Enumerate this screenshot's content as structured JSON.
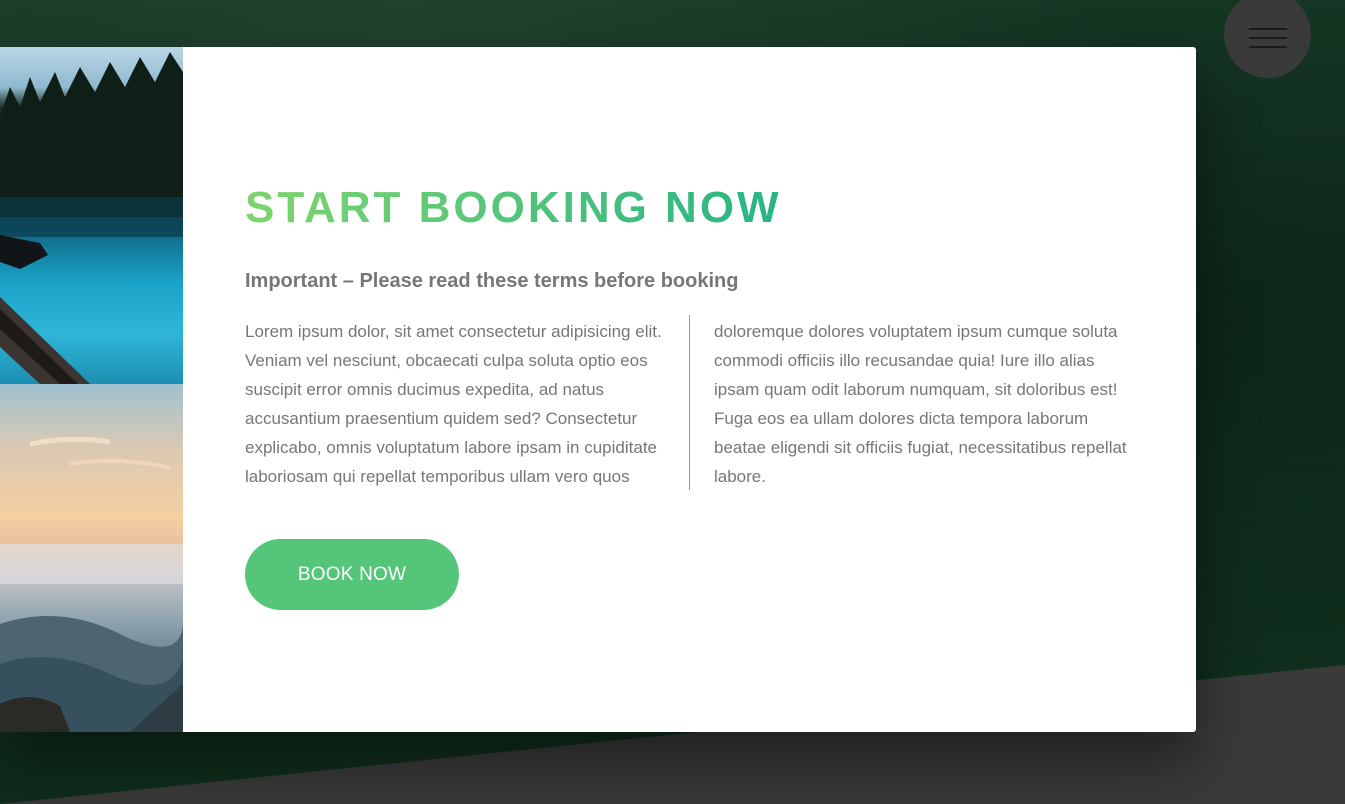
{
  "popup": {
    "title": "START BOOKING NOW",
    "subtitle": "Important – Please read these terms before booking",
    "text_col1": "Lorem ipsum dolor, sit amet consectetur adipisicing elit. Veniam vel nesciunt, obcaecati culpa soluta optio eos suscipit error omnis ducimus expedita, ad natus accusantium praesentium quidem sed? Consectetur explicabo, omnis voluptatum labore ipsam in cupiditate laboriosam qui repellat temporibus ullam vero quos",
    "text_col2": "doloremque dolores voluptatem ipsum cumque soluta commodi officiis illo recusandae quia! Iure illo alias ipsam quam odit laborum numquam, sit doloribus est! Fuga eos ea ullam dolores dicta tempora laborum beatae eligendi sit officiis fugiat, necessitatibus repellat labore.",
    "book_button_label": "Book now",
    "images": [
      "lake-with-boat-image",
      "mountain-sunrise-image"
    ]
  },
  "navigation": {
    "menu_icon": "hamburger-menu-icon"
  },
  "colors": {
    "accent_light": "#7ed56f",
    "accent_dark": "#28b485",
    "button_green": "#55c57a",
    "text_grey": "#777777",
    "background_dark_green": "#123321",
    "background_grey": "#3a3a3a"
  }
}
